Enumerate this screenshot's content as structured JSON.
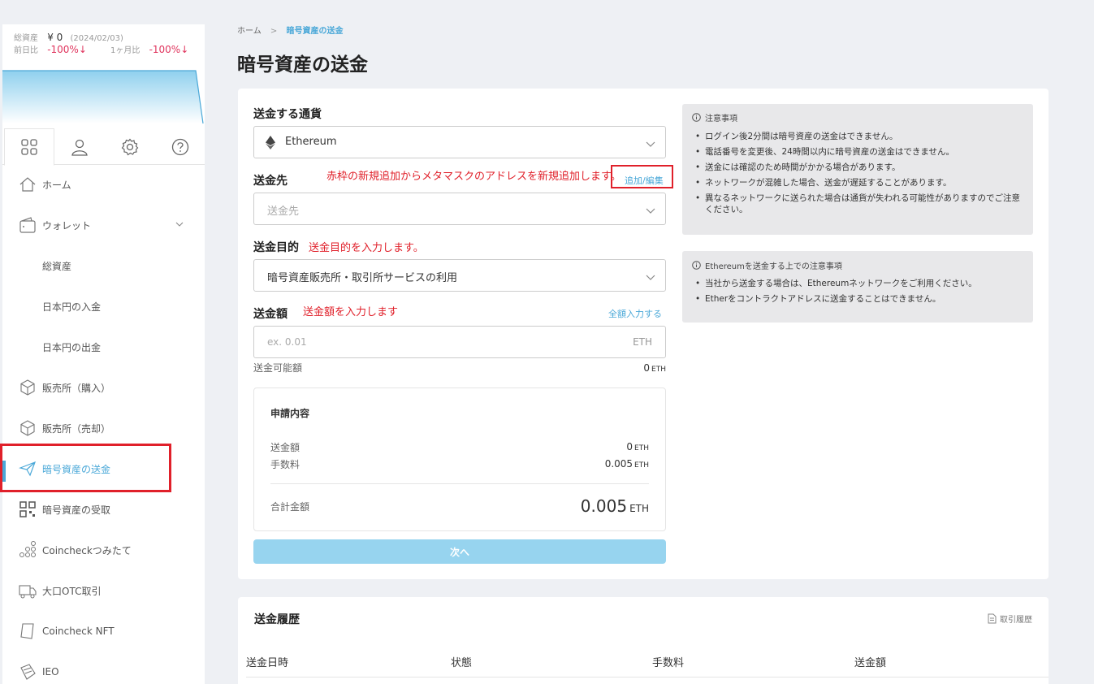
{
  "summary": {
    "total_label": "総資産",
    "total_value": "¥ 0",
    "date": "(2024/02/03)",
    "day_label": "前日比",
    "day_value": "-100%↓",
    "month_label": "1ヶ月比",
    "month_value": "-100%↓"
  },
  "sidebar": {
    "tabs": [
      "grid-icon",
      "user-icon",
      "gear-icon",
      "help-icon"
    ],
    "items": [
      {
        "label": "ホーム",
        "icon": "home-icon"
      },
      {
        "label": "ウォレット",
        "icon": "wallet-icon"
      },
      {
        "label": "総資産"
      },
      {
        "label": "日本円の入金"
      },
      {
        "label": "日本円の出金"
      },
      {
        "label": "販売所（購入）",
        "icon": "cube-icon"
      },
      {
        "label": "販売所（売却）",
        "icon": "cube-icon"
      },
      {
        "label": "暗号資産の送金",
        "icon": "send-icon"
      },
      {
        "label": "暗号資産の受取",
        "icon": "qr-icon"
      },
      {
        "label": "Coincheckつみたて",
        "icon": "coins-icon"
      },
      {
        "label": "大口OTC取引",
        "icon": "truck-icon"
      },
      {
        "label": "Coincheck NFT",
        "icon": "nft-icon"
      },
      {
        "label": "IEO",
        "icon": "ieo-icon"
      }
    ]
  },
  "breadcrumb": {
    "home": "ホーム",
    "sep": ">",
    "current": "暗号資産の送金"
  },
  "page_title": "暗号資産の送金",
  "form": {
    "currency_label": "送金する通貨",
    "currency_value": "Ethereum",
    "dest_label": "送金先",
    "dest_note": "赤枠の新規追加からメタマスクのアドレスを新規追加します。",
    "dest_link": "追加/編集",
    "dest_placeholder": "送金先",
    "purpose_label": "送金目的",
    "purpose_note": "送金目的を入力します。",
    "purpose_value": "暗号資産販売所・取引所サービスの利用",
    "amount_label": "送金額",
    "amount_note": "送金額を入力します",
    "amount_link": "全額入力する",
    "amount_placeholder": "ex. 0.01",
    "amount_unit": "ETH",
    "avail_label": "送金可能額",
    "avail_value": "0",
    "avail_unit": "ETH",
    "next_button": "次へ"
  },
  "application": {
    "title": "申請内容",
    "amount_label": "送金額",
    "amount_value": "0",
    "fee_label": "手数料",
    "fee_value": "0.005",
    "unit": "ETH",
    "total_label": "合計金額",
    "total_value": "0.005",
    "total_unit": "ETH"
  },
  "notice1": {
    "title": "注意事項",
    "items": [
      "ログイン後2分間は暗号資産の送金はできません。",
      "電話番号を変更後、24時間以内に暗号資産の送金はできません。",
      "送金には確認のため時間がかかる場合があります。",
      "ネットワークが混雑した場合、送金が遅延することがあります。",
      "異なるネットワークに送られた場合は通貨が失われる可能性がありますのでご注意ください。"
    ]
  },
  "notice2": {
    "title": "Ethereumを送金する上での注意事項",
    "items": [
      "当社から送金する場合は、Ethereumネットワークをご利用ください。",
      "Etherをコントラクトアドレスに送金することはできません。"
    ]
  },
  "history": {
    "title": "送金履歴",
    "link": "取引履歴",
    "columns": [
      "送金日時",
      "状態",
      "手数料",
      "送金額"
    ]
  },
  "colors": {
    "accent": "#4aa8d8",
    "negative": "#e0345d",
    "annotation": "#e0202a"
  }
}
